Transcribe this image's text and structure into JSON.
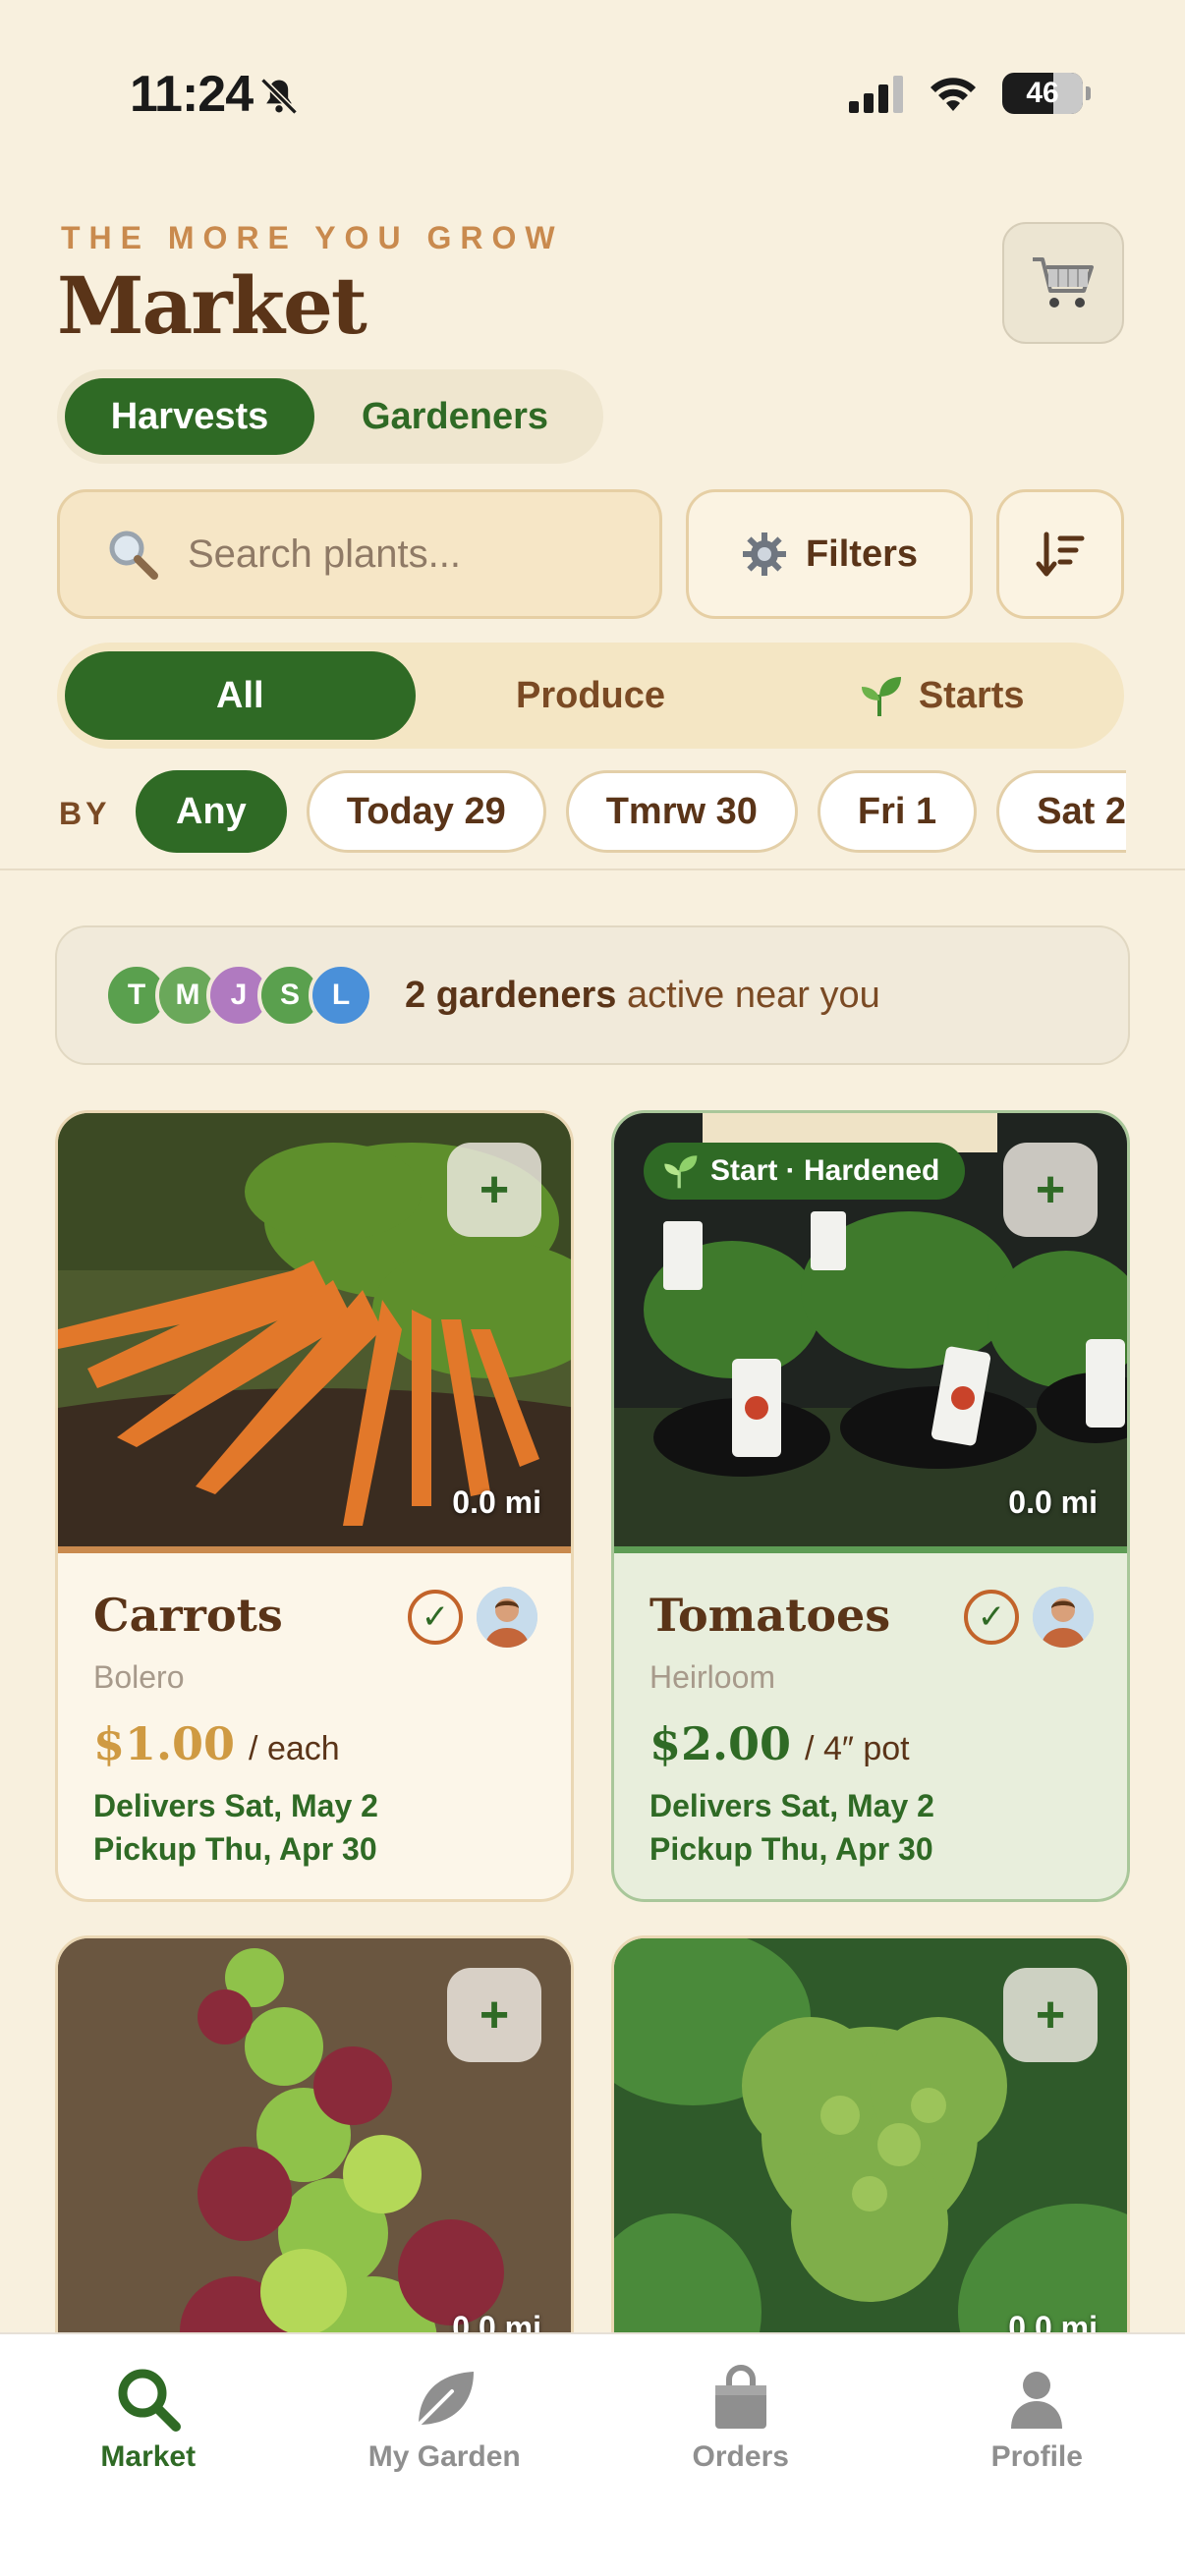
{
  "status": {
    "time": "11:24",
    "battery": "46"
  },
  "header": {
    "tagline": "THE MORE YOU GROW",
    "title": "Market"
  },
  "toggle": {
    "active": "Harvests",
    "inactive": "Gardeners"
  },
  "search": {
    "placeholder": "Search plants...",
    "filters_label": "Filters"
  },
  "categories": [
    {
      "label": "All",
      "icon": "",
      "selected": true
    },
    {
      "label": "Produce",
      "icon": "",
      "selected": false
    },
    {
      "label": "Starts",
      "icon": "sprout-icon",
      "selected": false
    }
  ],
  "dates": {
    "by_label": "BY",
    "chips": [
      "Any",
      "Today 29",
      "Tmrw 30",
      "Fri 1",
      "Sat 2"
    ],
    "selected": "Any"
  },
  "active_banner": {
    "avatars": [
      {
        "initial": "T",
        "color": "#5aa04e"
      },
      {
        "initial": "M",
        "color": "#6aa85a"
      },
      {
        "initial": "J",
        "color": "#b07ac0"
      },
      {
        "initial": "S",
        "color": "#5aa04e"
      },
      {
        "initial": "L",
        "color": "#4a90d9"
      }
    ],
    "count_text": "2 gardeners",
    "rest_text": " active near you"
  },
  "listings": [
    {
      "name": "Carrots",
      "variety": "Bolero",
      "price": "$1.00",
      "unit": "/ each",
      "delivers": "Delivers Sat, May 2",
      "pickup": "Pickup Thu, Apr 30",
      "distance": "0.0 mi",
      "type": "produce",
      "badge": ""
    },
    {
      "name": "Tomatoes",
      "variety": "Heirloom",
      "price": "$2.00",
      "unit": "/ 4″ pot",
      "delivers": "Delivers Sat, May 2",
      "pickup": "Pickup Thu, Apr 30",
      "distance": "0.0 mi",
      "type": "start",
      "badge": "Start · Hardened"
    },
    {
      "name": "",
      "variety": "",
      "price": "",
      "unit": "",
      "delivers": "",
      "pickup": "",
      "distance": "0.0 mi",
      "type": "produce",
      "badge": ""
    },
    {
      "name": "",
      "variety": "",
      "price": "",
      "unit": "",
      "delivers": "",
      "pickup": "",
      "distance": "0.0 mi",
      "type": "produce",
      "badge": ""
    }
  ],
  "nav": [
    {
      "label": "Market",
      "icon": "search-icon",
      "active": true
    },
    {
      "label": "My Garden",
      "icon": "leaf-icon",
      "active": false
    },
    {
      "label": "Orders",
      "icon": "bag-icon",
      "active": false
    },
    {
      "label": "Profile",
      "icon": "person-icon",
      "active": false
    }
  ],
  "colors": {
    "accent": "#2f6a25",
    "brown": "#5a3418",
    "background": "#f8f0de"
  }
}
